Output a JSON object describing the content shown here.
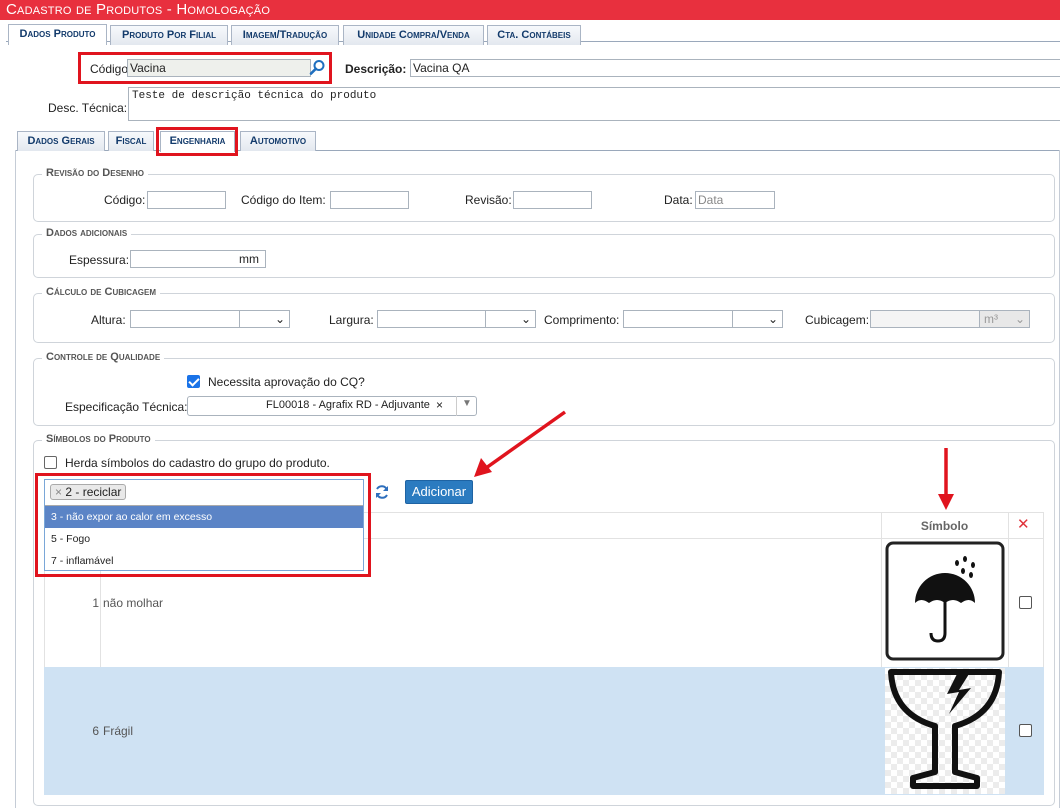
{
  "title": "Cadastro de Produtos - Homologação",
  "top_tabs": [
    "Dados Produto",
    "Produto Por Filial",
    "Imagem/Tradução",
    "Unidade Compra/Venda",
    "Cta. Contábeis"
  ],
  "header": {
    "codigo_label": "Código",
    "codigo_value": "Vacina",
    "descricao_label": "Descrição:",
    "descricao_value": "Vacina QA",
    "desc_tecnica_label": "Desc. Técnica:",
    "desc_tecnica_value": "Teste de descrição técnica do produto"
  },
  "sub_tabs": [
    "Dados Gerais",
    "Fiscal",
    "Engenharia",
    "Automotivo"
  ],
  "revisao": {
    "legend": "Revisão do Desenho",
    "codigo_label": "Código:",
    "codigo_item_label": "Código do Item:",
    "revisao_label": "Revisão:",
    "data_label": "Data:",
    "data_placeholder": "Data"
  },
  "adicionais": {
    "legend": "Dados adicionais",
    "espessura_label": "Espessura:",
    "unit": "mm"
  },
  "cubicagem": {
    "legend": "Cálculo de Cubicagem",
    "altura_label": "Altura:",
    "largura_label": "Largura:",
    "comprimento_label": "Comprimento:",
    "cubicagem_label": "Cubicagem:",
    "unit": "m³"
  },
  "qualidade": {
    "legend": "Controle de Qualidade",
    "cq_label": "Necessita aprovação do CQ?",
    "cq_checked": true,
    "espec_label": "Especificação Técnica:",
    "espec_value": "FL00018 - Agrafix RD - Adjuvante",
    "espec_clear": "×"
  },
  "simbolos": {
    "legend": "Símbolos do Produto",
    "herda_label": "Herda símbolos do cadastro do grupo do produto.",
    "selected_tag": "2 - reciclar",
    "tag_remove": "×",
    "options": [
      "3 - não expor ao calor em excesso",
      "5 - Fogo",
      "7 - inflamável"
    ],
    "add_button": "Adicionar",
    "col_simbolo": "Símbolo",
    "delete_col": "✕",
    "rows": [
      {
        "num": "1",
        "name": "não molhar",
        "icon": "umbrella-rain-icon"
      },
      {
        "num": "6",
        "name": "Frágil",
        "icon": "fragile-glass-icon"
      }
    ]
  },
  "colors": {
    "title_bar": "#e8303e",
    "accent": "#1a73e8",
    "highlight": "#dde7f2",
    "annotation": "#e0141e"
  }
}
